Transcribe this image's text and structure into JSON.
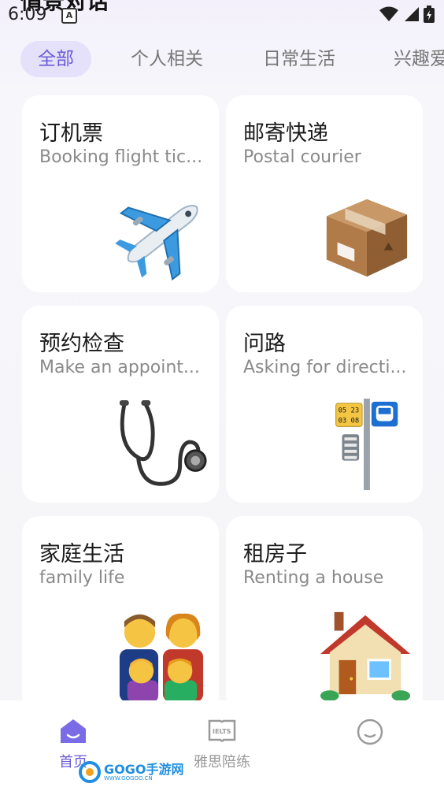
{
  "status_bar": {
    "time": "6:09",
    "badge": "A"
  },
  "header": {
    "title": "情景对话"
  },
  "tabs": [
    {
      "label": "全部",
      "active": true
    },
    {
      "label": "个人相关",
      "active": false
    },
    {
      "label": "日常生活",
      "active": false
    },
    {
      "label": "兴趣爱",
      "active": false
    }
  ],
  "cards": [
    {
      "title": "订机票",
      "subtitle": "Booking flight tic...",
      "icon": "airplane-icon"
    },
    {
      "title": "邮寄快递",
      "subtitle": "Postal courier",
      "icon": "package-icon"
    },
    {
      "title": "预约检查",
      "subtitle": "Make an appoint...",
      "icon": "stethoscope-icon"
    },
    {
      "title": "问路",
      "subtitle": "Asking for directi...",
      "icon": "bus-stop-icon"
    },
    {
      "title": "家庭生活",
      "subtitle": "family life",
      "icon": "family-icon"
    },
    {
      "title": "租房子",
      "subtitle": "Renting a house",
      "icon": "house-icon"
    }
  ],
  "bus_stop": {
    "line1": "05 23",
    "line2": "03 08"
  },
  "bottom_nav": [
    {
      "label": "首页",
      "icon": "home-icon",
      "active": true
    },
    {
      "label": "雅思陪练",
      "icon": "ielts-book-icon",
      "active": false,
      "icon_text": "IELTS"
    },
    {
      "label": "",
      "icon": "profile-icon",
      "active": false
    }
  ],
  "watermark": {
    "brand": "GOGO手游网",
    "url": "WWW.GOGOO.CN"
  },
  "colors": {
    "accent": "#6a5bd6",
    "tab_active_bg": "#e6e1fa",
    "inactive": "#9a9a9a"
  }
}
